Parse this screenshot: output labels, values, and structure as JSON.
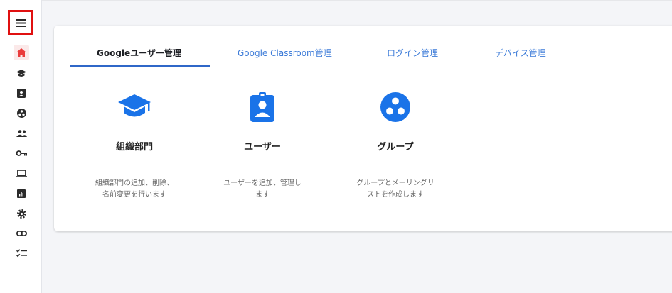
{
  "colors": {
    "accent": "#2f67c8",
    "icon_blue": "#1a73e8",
    "highlight_red": "#e01010",
    "home_active": "#ea3c3c",
    "sidebar_icon": "#2b2b2b"
  },
  "sidebar": {
    "menu_icon": "hamburger-menu-icon",
    "items": [
      {
        "icon": "home-icon"
      },
      {
        "icon": "school-icon"
      },
      {
        "icon": "badge-icon"
      },
      {
        "icon": "groups-icon"
      },
      {
        "icon": "people-icon"
      },
      {
        "icon": "key-icon"
      },
      {
        "icon": "laptop-icon"
      },
      {
        "icon": "report-icon"
      },
      {
        "icon": "settings-icon"
      },
      {
        "icon": "link-icon"
      },
      {
        "icon": "checklist-icon"
      }
    ]
  },
  "tabs": [
    {
      "label": "Googleユーザー管理",
      "active": true
    },
    {
      "label": "Google Classroom管理",
      "active": false
    },
    {
      "label": "ログイン管理",
      "active": false
    },
    {
      "label": "デバイス管理",
      "active": false
    }
  ],
  "tiles": [
    {
      "title": "組織部門",
      "desc_line1": "組織部門の追加、削除、",
      "desc_line2": "名前変更を行います",
      "icon": "school-icon"
    },
    {
      "title": "ユーザー",
      "desc_line1": "ユーザーを追加、管理し",
      "desc_line2": "ます",
      "icon": "badge-icon"
    },
    {
      "title": "グループ",
      "desc_line1": "グループとメーリングリ",
      "desc_line2": "ストを作成します",
      "icon": "groups-icon"
    }
  ]
}
